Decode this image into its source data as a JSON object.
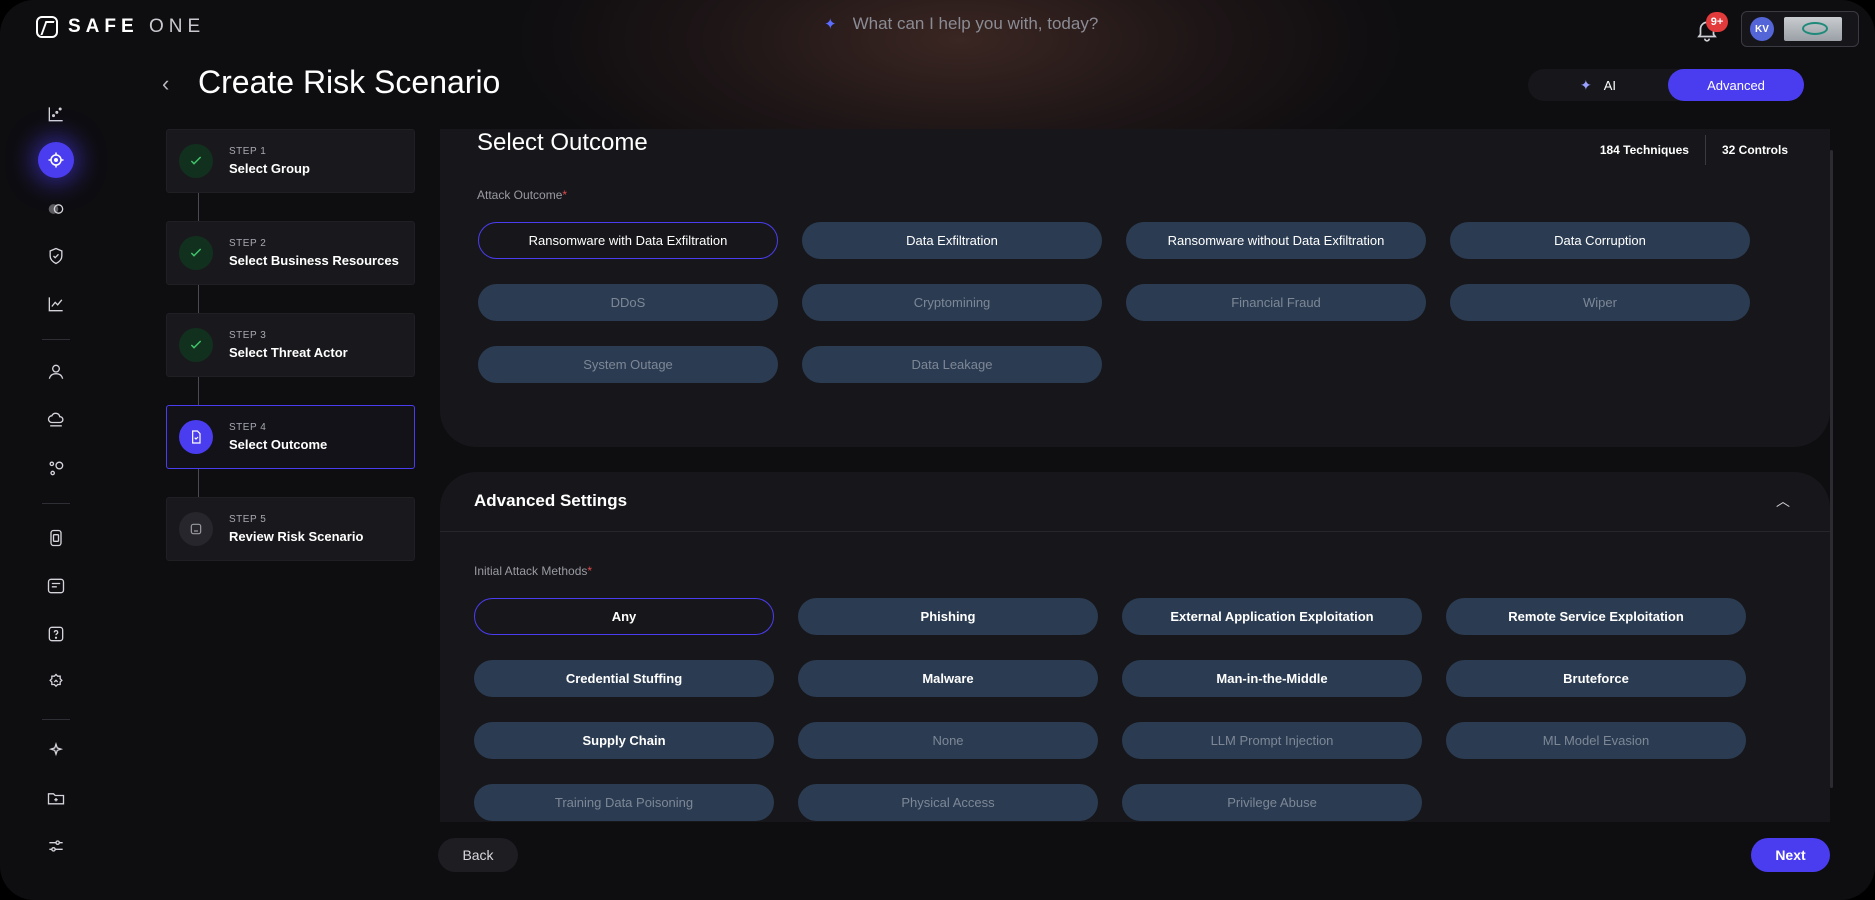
{
  "brand": {
    "name_bold": "SAFE",
    "name_light": "ONE",
    "icon": "safe-logo-icon"
  },
  "search": {
    "placeholder": "What can I help you with, today?",
    "icon": "sparkle-icon"
  },
  "notifications": {
    "badge": "9+",
    "icon": "bell-icon"
  },
  "user": {
    "initials": "KV"
  },
  "rail": {
    "icons": [
      "dashboard-icon",
      "risk-target-icon",
      "toggle-icon",
      "shield-check-icon",
      "trend-chart-icon",
      "user-icon",
      "cloud-icon",
      "integrations-icon",
      "report-icon",
      "list-icon",
      "help-icon",
      "settings-gear-icon",
      "sparkle-icon",
      "folder-add-icon",
      "sliders-icon"
    ],
    "active": "risk-target-icon"
  },
  "header": {
    "title": "Create Risk Scenario",
    "mode_ai": "AI",
    "mode_advanced": "Advanced"
  },
  "steps": [
    {
      "num": "STEP 1",
      "label": "Select Group",
      "state": "done"
    },
    {
      "num": "STEP 2",
      "label": "Select Business Resources",
      "state": "done"
    },
    {
      "num": "STEP 3",
      "label": "Select Threat Actor",
      "state": "done"
    },
    {
      "num": "STEP 4",
      "label": "Select Outcome",
      "state": "current"
    },
    {
      "num": "STEP 5",
      "label": "Review Risk Scenario",
      "state": "todo"
    }
  ],
  "outcome": {
    "title": "Select Outcome",
    "techniques": "184 Techniques",
    "controls": "32 Controls",
    "field_label": "Attack Outcome",
    "required_mark": "*",
    "options": [
      {
        "label": "Ransomware with Data Exfiltration",
        "state": "selected"
      },
      {
        "label": "Data Exfiltration",
        "state": "enabled"
      },
      {
        "label": "Ransomware without Data Exfiltration",
        "state": "enabled"
      },
      {
        "label": "Data Corruption",
        "state": "enabled"
      },
      {
        "label": "DDoS",
        "state": "disabled"
      },
      {
        "label": "Cryptomining",
        "state": "disabled"
      },
      {
        "label": "Financial Fraud",
        "state": "disabled"
      },
      {
        "label": "Wiper",
        "state": "disabled"
      },
      {
        "label": "System Outage",
        "state": "disabled"
      },
      {
        "label": "Data Leakage",
        "state": "disabled"
      }
    ]
  },
  "advanced": {
    "title": "Advanced Settings",
    "field_label": "Initial Attack Methods",
    "required_mark": "*",
    "options": [
      {
        "label": "Any",
        "state": "selected"
      },
      {
        "label": "Phishing",
        "state": "enabled"
      },
      {
        "label": "External Application Exploitation",
        "state": "enabled"
      },
      {
        "label": "Remote Service Exploitation",
        "state": "enabled"
      },
      {
        "label": "Credential Stuffing",
        "state": "enabled"
      },
      {
        "label": "Malware",
        "state": "enabled"
      },
      {
        "label": "Man-in-the-Middle",
        "state": "enabled"
      },
      {
        "label": "Bruteforce",
        "state": "enabled"
      },
      {
        "label": "Supply Chain",
        "state": "enabled"
      },
      {
        "label": "None",
        "state": "disabled"
      },
      {
        "label": "LLM Prompt Injection",
        "state": "disabled"
      },
      {
        "label": "ML Model Evasion",
        "state": "disabled"
      },
      {
        "label": "Training Data Poisoning",
        "state": "disabled"
      },
      {
        "label": "Physical Access",
        "state": "disabled"
      },
      {
        "label": "Privilege Abuse",
        "state": "disabled"
      }
    ]
  },
  "footer": {
    "back": "Back",
    "next": "Next"
  },
  "colors": {
    "accent": "#4a3df0",
    "pill": "#2b3c52",
    "panel": "#17171b",
    "done": "#3fc46a",
    "required": "#e04a4a"
  }
}
